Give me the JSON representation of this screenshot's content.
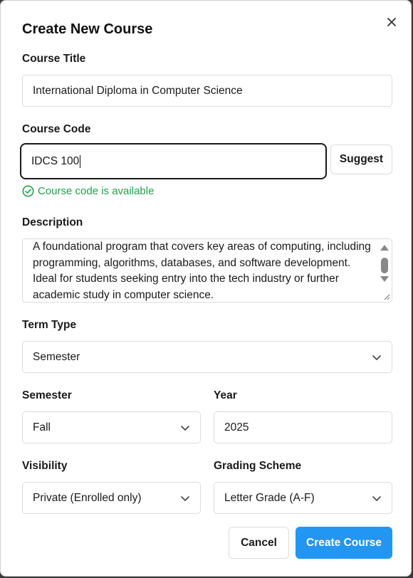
{
  "dialog": {
    "title": "Create New Course",
    "close_icon": "close-icon"
  },
  "course_title": {
    "label": "Course Title",
    "value": "International Diploma in Computer Science"
  },
  "course_code": {
    "label": "Course Code",
    "value": "IDCS 100",
    "suggest_label": "Suggest",
    "status_text": "Course code is available",
    "status_icon": "check-circle-icon",
    "status_color": "#22a04b"
  },
  "description": {
    "label": "Description",
    "value": "A foundational program that covers key areas of computing, including programming, algorithms, databases, and software development. Ideal for students seeking entry into the tech industry or further academic study in computer science."
  },
  "term_type": {
    "label": "Term Type",
    "selected": "Semester",
    "icon": "chevron-down-icon"
  },
  "semester": {
    "label": "Semester",
    "selected": "Fall",
    "icon": "chevron-down-icon"
  },
  "year": {
    "label": "Year",
    "value": "2025"
  },
  "visibility": {
    "label": "Visibility",
    "selected": "Private (Enrolled only)",
    "icon": "chevron-down-icon"
  },
  "grading_scheme": {
    "label": "Grading Scheme",
    "selected": "Letter Grade (A-F)",
    "icon": "chevron-down-icon"
  },
  "actions": {
    "cancel_label": "Cancel",
    "create_label": "Create Course",
    "primary_color": "#2196f3"
  }
}
